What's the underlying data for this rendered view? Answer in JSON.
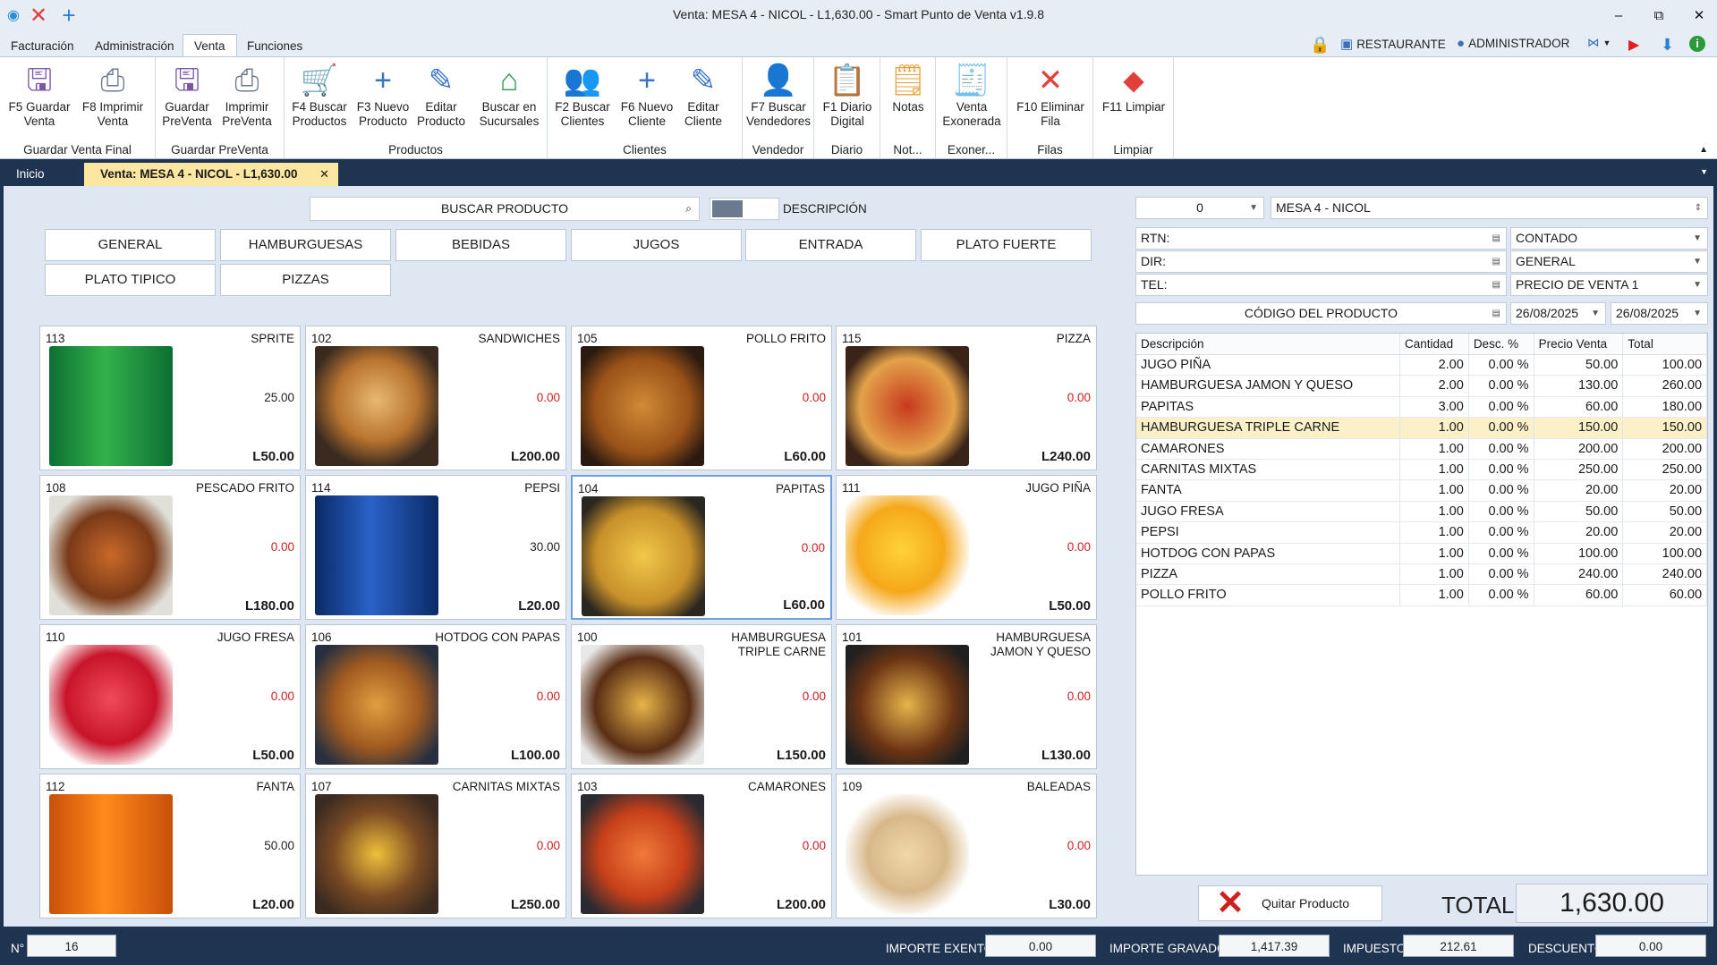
{
  "window": {
    "title": "Venta: MESA 4 - NICOL - L1,630.00 - Smart Punto de Venta v1.9.8",
    "minimize": "–",
    "restore": "⧉",
    "close": "✕"
  },
  "menu": {
    "tabs": [
      "Facturación",
      "Administración",
      "Venta",
      "Funciones"
    ],
    "restaurante": "RESTAURANTE",
    "administrador": "ADMINISTRADOR"
  },
  "ribbon": {
    "buttons": [
      {
        "label": "F5 Guardar\nVenta",
        "icon": "save-icon"
      },
      {
        "label": "F8 Imprimir\nVenta",
        "icon": "printer-icon"
      },
      {
        "label": "Guardar\nPreVenta",
        "icon": "save-icon"
      },
      {
        "label": "Imprimir\nPreVenta",
        "icon": "printer-icon"
      },
      {
        "label": "F4 Buscar\nProductos",
        "icon": "cart-icon"
      },
      {
        "label": "F3 Nuevo\nProducto",
        "icon": "plus-icon"
      },
      {
        "label": "Editar\nProducto",
        "icon": "pencil-icon"
      },
      {
        "label": "Buscar en\nSucursales",
        "icon": "house-icon"
      },
      {
        "label": "F2 Buscar\nClientes",
        "icon": "users-icon"
      },
      {
        "label": "F6 Nuevo\nCliente",
        "icon": "plus-icon"
      },
      {
        "label": "Editar\nCliente",
        "icon": "pencil-icon"
      },
      {
        "label": "F7 Buscar\nVendedores",
        "icon": "user-icon"
      },
      {
        "label": "F1 Diario\nDigital",
        "icon": "clipboard-icon"
      },
      {
        "label": "Notas",
        "icon": "notes-icon"
      },
      {
        "label": "Venta\nExonerada",
        "icon": "invoice-icon"
      },
      {
        "label": "F10 Eliminar\nFila",
        "icon": "x-icon"
      },
      {
        "label": "F11 Limpiar",
        "icon": "eraser-icon"
      }
    ],
    "groups": [
      "Guardar Venta Final",
      "Guardar PreVenta",
      "Productos",
      "Clientes",
      "Vendedor",
      "Diario",
      "Not...",
      "Exoner...",
      "Filas",
      "Limpiar"
    ]
  },
  "doctabs": {
    "home": "Inicio",
    "active": "Venta: MESA 4 - NICOL - L1,630.00",
    "close": "✕"
  },
  "search": {
    "placeholder": "BUSCAR PRODUCTO",
    "toggle_label": "DESCRIPCIÓN"
  },
  "categories": [
    "GENERAL",
    "HAMBURGUESAS",
    "BEBIDAS",
    "JUGOS",
    "ENTRADA",
    "PLATO FUERTE",
    "PLATO TIPICO",
    "PIZZAS"
  ],
  "products": [
    {
      "code": "113",
      "name": "SPRITE",
      "stock": "25.00",
      "price": "L50.00",
      "img": "sprite"
    },
    {
      "code": "102",
      "name": "SANDWICHES",
      "stock": "0.00",
      "price": "L200.00",
      "img": "sandwich"
    },
    {
      "code": "105",
      "name": "POLLO FRITO",
      "stock": "0.00",
      "price": "L60.00",
      "img": "chicken"
    },
    {
      "code": "115",
      "name": "PIZZA",
      "stock": "0.00",
      "price": "L240.00",
      "img": "pizza"
    },
    {
      "code": "108",
      "name": "PESCADO FRITO",
      "stock": "0.00",
      "price": "L180.00",
      "img": "fish"
    },
    {
      "code": "114",
      "name": "PEPSI",
      "stock": "30.00",
      "price": "L20.00",
      "img": "pepsi"
    },
    {
      "code": "104",
      "name": "PAPITAS",
      "stock": "0.00",
      "price": "L60.00",
      "img": "fries"
    },
    {
      "code": "111",
      "name": "JUGO PIÑA",
      "stock": "0.00",
      "price": "L50.00",
      "img": "juice"
    },
    {
      "code": "110",
      "name": "JUGO FRESA",
      "stock": "0.00",
      "price": "L50.00",
      "img": "strawberry"
    },
    {
      "code": "106",
      "name": "HOTDOG CON PAPAS",
      "stock": "0.00",
      "price": "L100.00",
      "img": "hotdog"
    },
    {
      "code": "100",
      "name": "HAMBURGUESA TRIPLE CARNE",
      "stock": "0.00",
      "price": "L150.00",
      "img": "burger"
    },
    {
      "code": "101",
      "name": "HAMBURGUESA JAMON Y QUESO",
      "stock": "0.00",
      "price": "L130.00",
      "img": "burger2"
    },
    {
      "code": "112",
      "name": "FANTA",
      "stock": "50.00",
      "price": "L20.00",
      "img": "fanta"
    },
    {
      "code": "107",
      "name": "CARNITAS MIXTAS",
      "stock": "0.00",
      "price": "L250.00",
      "img": "grill"
    },
    {
      "code": "103",
      "name": "CAMARONES",
      "stock": "0.00",
      "price": "L200.00",
      "img": "shrimp"
    },
    {
      "code": "109",
      "name": "BALEADAS",
      "stock": "0.00",
      "price": "L30.00",
      "img": "baleada"
    }
  ],
  "customer": {
    "number": "0",
    "table": "MESA 4 - NICOL",
    "rtn": "RTN:",
    "dir": "DIR:",
    "tel": "TEL:",
    "payment": "CONTADO",
    "type": "GENERAL",
    "price_list": "PRECIO DE VENTA 1",
    "product_code_placeholder": "CÓDIGO DEL PRODUCTO",
    "date_from": "26/08/2025",
    "date_to": "26/08/2025"
  },
  "grid": {
    "headers": [
      "Descripción",
      "Cantidad",
      "Desc. %",
      "Precio Venta",
      "Total"
    ],
    "rows": [
      [
        "JUGO PIÑA",
        "2.00",
        "0.00 %",
        "50.00",
        "100.00"
      ],
      [
        "HAMBURGUESA JAMON Y QUESO",
        "2.00",
        "0.00 %",
        "130.00",
        "260.00"
      ],
      [
        "PAPITAS",
        "3.00",
        "0.00 %",
        "60.00",
        "180.00"
      ],
      [
        "HAMBURGUESA TRIPLE CARNE",
        "1.00",
        "0.00 %",
        "150.00",
        "150.00"
      ],
      [
        "CAMARONES",
        "1.00",
        "0.00 %",
        "200.00",
        "200.00"
      ],
      [
        "CARNITAS MIXTAS",
        "1.00",
        "0.00 %",
        "250.00",
        "250.00"
      ],
      [
        "FANTA",
        "1.00",
        "0.00 %",
        "20.00",
        "20.00"
      ],
      [
        "JUGO FRESA",
        "1.00",
        "0.00 %",
        "50.00",
        "50.00"
      ],
      [
        "PEPSI",
        "1.00",
        "0.00 %",
        "20.00",
        "20.00"
      ],
      [
        "HOTDOG CON PAPAS",
        "1.00",
        "0.00 %",
        "100.00",
        "100.00"
      ],
      [
        "PIZZA",
        "1.00",
        "0.00 %",
        "240.00",
        "240.00"
      ],
      [
        "POLLO FRITO",
        "1.00",
        "0.00 %",
        "60.00",
        "60.00"
      ]
    ],
    "highlighted_row": 3
  },
  "actions": {
    "remove_product": "Quitar Producto"
  },
  "totals": {
    "label": "TOTAL",
    "value": "1,630.00"
  },
  "status": {
    "n_label": "N°",
    "n_value": "16",
    "exento_label": "IMPORTE EXENTO",
    "exento_value": "0.00",
    "gravado_label": "IMPORTE GRAVADO",
    "gravado_value": "1,417.39",
    "impuesto_label": "IMPUESTO",
    "impuesto_value": "212.61",
    "descuento_label": "DESCUENTO",
    "descuento_value": "0.00"
  },
  "colors": {
    "accent_tab": "#fbe7a1",
    "header_bg": "#1f3450",
    "highlight_row": "#fbf0c8",
    "negative_stock": "#cc1e1e"
  }
}
